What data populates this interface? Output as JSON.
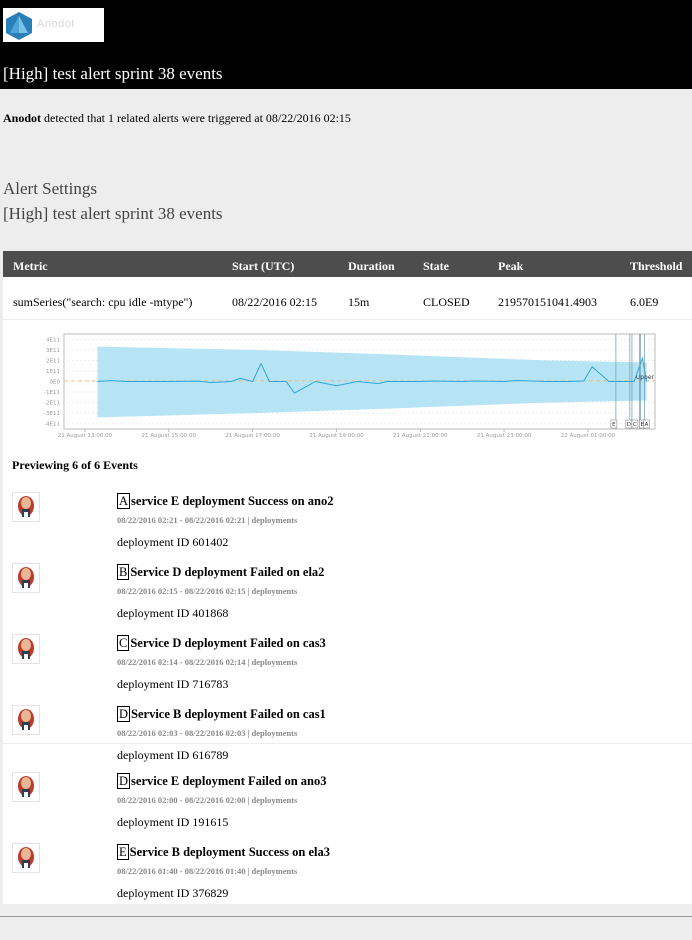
{
  "header": {
    "logo_text": "Anodot",
    "title": "[High] test alert sprint 38 events"
  },
  "intro": {
    "brand": "Anodot",
    "text": " detected that 1 related alerts were triggered at 08/22/2016 02:15"
  },
  "settings": {
    "heading": "Alert Settings",
    "alert_name": "[High] test alert sprint 38 events"
  },
  "table": {
    "columns": [
      "Metric",
      "Start (UTC)",
      "Duration",
      "State",
      "Peak",
      "Threshold"
    ],
    "rows": [
      [
        "sumSeries(\"search: cpu idle -mtype\")",
        "08/22/2016 02:15",
        "15m",
        "CLOSED",
        "219570151041.4903",
        "6.0E9"
      ]
    ]
  },
  "chart_data": {
    "type": "line",
    "title": "",
    "xlabel": "",
    "ylabel": "",
    "y_ticks": [
      "4E11",
      "3E11",
      "2E11",
      "1E11",
      "0E0",
      "-1E11",
      "-2E11",
      "-3E11",
      "-4E11"
    ],
    "ylim": [
      -450000000000,
      450000000000
    ],
    "x_ticks": [
      "21 August 13:00:00",
      "21 August 15:00:00",
      "21 August 17:00:00",
      "21 August 19:00:00",
      "21 August 21:00:00",
      "21 August 23:00:00",
      "22 August 01:00:00"
    ],
    "xlim_hours": [
      12.5,
      26.6
    ],
    "threshold_label": "Upper",
    "threshold": 6000000000,
    "series": [
      {
        "name": "metric",
        "x_hours": [
          13.3,
          13.6,
          14.0,
          15.0,
          15.7,
          16.0,
          16.5,
          16.7,
          17.0,
          17.2,
          17.4,
          17.8,
          18.0,
          18.5,
          19.0,
          19.5,
          20.0,
          20.2,
          21.0,
          21.3,
          22.0,
          22.3,
          23.0,
          23.3,
          24.0,
          24.5,
          24.9,
          25.1,
          25.5,
          26.0,
          26.1,
          26.3,
          26.4
        ],
        "values": [
          0,
          8000000000.0,
          0,
          0,
          3000000000.0,
          -10000000000.0,
          0,
          30000000000.0,
          0,
          170000000000.0,
          0,
          0,
          -110000000000.0,
          0,
          -40000000000.0,
          0,
          -20000000000.0,
          0,
          0,
          5000000000.0,
          0,
          5000000000.0,
          0,
          10000000000.0,
          0,
          0,
          5000000000.0,
          140000000000.0,
          0,
          0,
          0,
          220000000000.0,
          0
        ]
      },
      {
        "name": "upper_band",
        "x_hours": [
          13.3,
          17.0,
          20.0,
          24.0,
          26.4
        ],
        "values": [
          330000000000.0,
          300000000000.0,
          260000000000.0,
          200000000000.0,
          180000000000.0
        ]
      },
      {
        "name": "lower_band",
        "x_hours": [
          13.3,
          17.0,
          20.0,
          24.0,
          26.4
        ],
        "values": [
          -340000000000.0,
          -300000000000.0,
          -260000000000.0,
          -200000000000.0,
          -180000000000.0
        ]
      }
    ],
    "event_markers": [
      {
        "label": "E",
        "x_hours": 25.667
      },
      {
        "label": "D",
        "x_hours": 26.0
      },
      {
        "label": "D",
        "x_hours": 26.05
      },
      {
        "label": "C",
        "x_hours": 26.233
      },
      {
        "label": "B",
        "x_hours": 26.25
      },
      {
        "label": "A",
        "x_hours": 26.35
      }
    ],
    "colors": {
      "band": "#b6e4f5",
      "line": "#29a8e0",
      "threshold": "#f0b070",
      "marker": "#6a9bb0"
    }
  },
  "events": {
    "title": "Previewing 6 of 6 Events",
    "items": [
      {
        "letter": "A",
        "title": "service E deployment Success on ano2",
        "meta": "08/22/2016 02:21 - 08/22/2016 02:21 | deployments",
        "body": "deployment ID 601402"
      },
      {
        "letter": "B",
        "title": "Service D deployment Failed on ela2",
        "meta": "08/22/2016 02:15 - 08/22/2016 02:15 | deployments",
        "body": "deployment ID 401868"
      },
      {
        "letter": "C",
        "title": "Service D deployment Failed on cas3",
        "meta": "08/22/2016 02:14 - 08/22/2016 02:14 | deployments",
        "body": "deployment ID 716783"
      },
      {
        "letter": "D",
        "title": "Service B deployment Failed on cas1",
        "meta": "08/22/2016 02:03 - 08/22/2016 02:03 | deployments",
        "body": "deployment ID 616789"
      },
      {
        "letter": "D",
        "title": "service E deployment Failed on ano3",
        "meta": "08/22/2016 02:00 - 08/22/2016 02:00 | deployments",
        "body": "deployment ID 191615"
      },
      {
        "letter": "E",
        "title": "Service B deployment Success on ela3",
        "meta": "08/22/2016 01:40 - 08/22/2016 01:40 | deployments",
        "body": "deployment ID 376829"
      }
    ]
  }
}
